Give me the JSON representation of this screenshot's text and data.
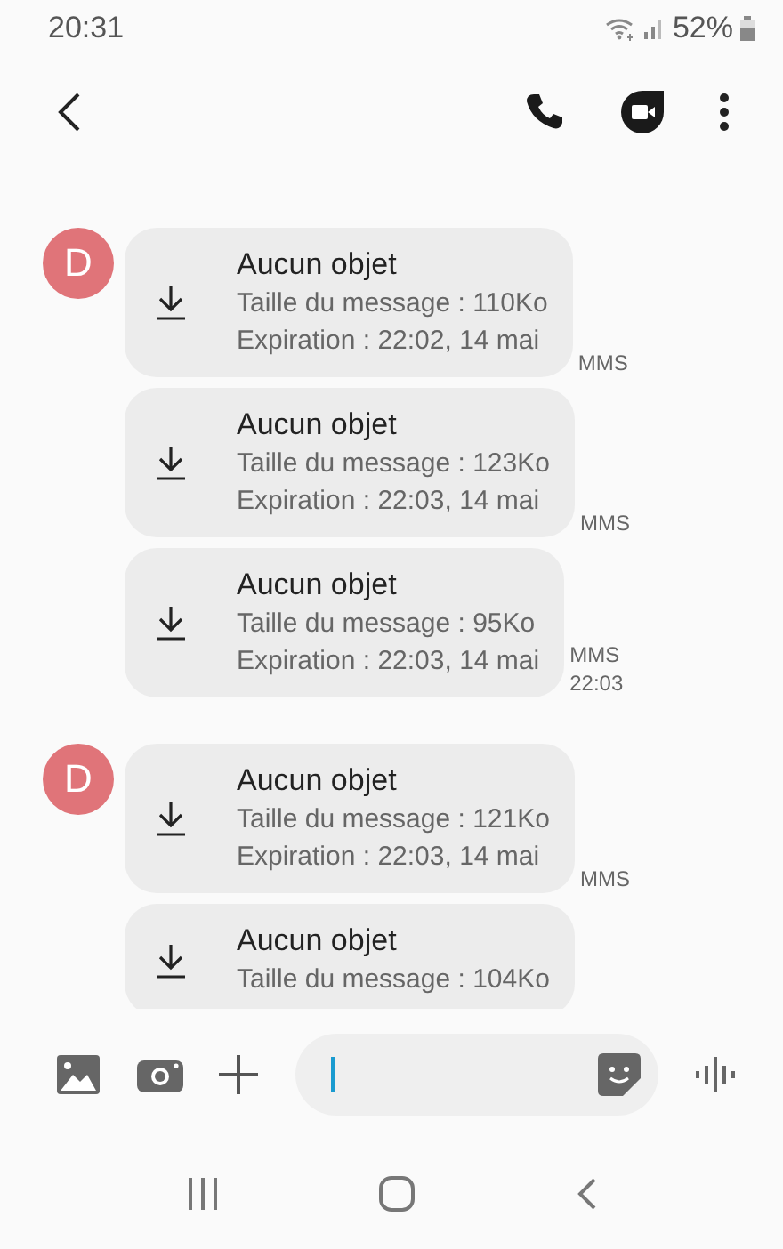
{
  "status_bar": {
    "time": "20:31",
    "battery": "52%"
  },
  "groups": [
    {
      "avatar": "D",
      "messages": [
        {
          "title": "Aucun objet",
          "size": "Taille du message : 110Ko",
          "expiration": "Expiration : 22:02, 14 mai",
          "meta": [
            "MMS"
          ]
        },
        {
          "title": "Aucun objet",
          "size": "Taille du message : 123Ko",
          "expiration": "Expiration : 22:03, 14 mai",
          "meta": [
            "MMS"
          ]
        },
        {
          "title": "Aucun objet",
          "size": "Taille du message : 95Ko",
          "expiration": "Expiration : 22:03, 14 mai",
          "meta": [
            "MMS",
            "22:03"
          ]
        }
      ]
    },
    {
      "avatar": "D",
      "messages": [
        {
          "title": "Aucun objet",
          "size": "Taille du message : 121Ko",
          "expiration": "Expiration : 22:03, 14 mai",
          "meta": [
            "MMS"
          ]
        },
        {
          "title": "Aucun objet",
          "size": "Taille du message : 104Ko"
        }
      ]
    }
  ]
}
